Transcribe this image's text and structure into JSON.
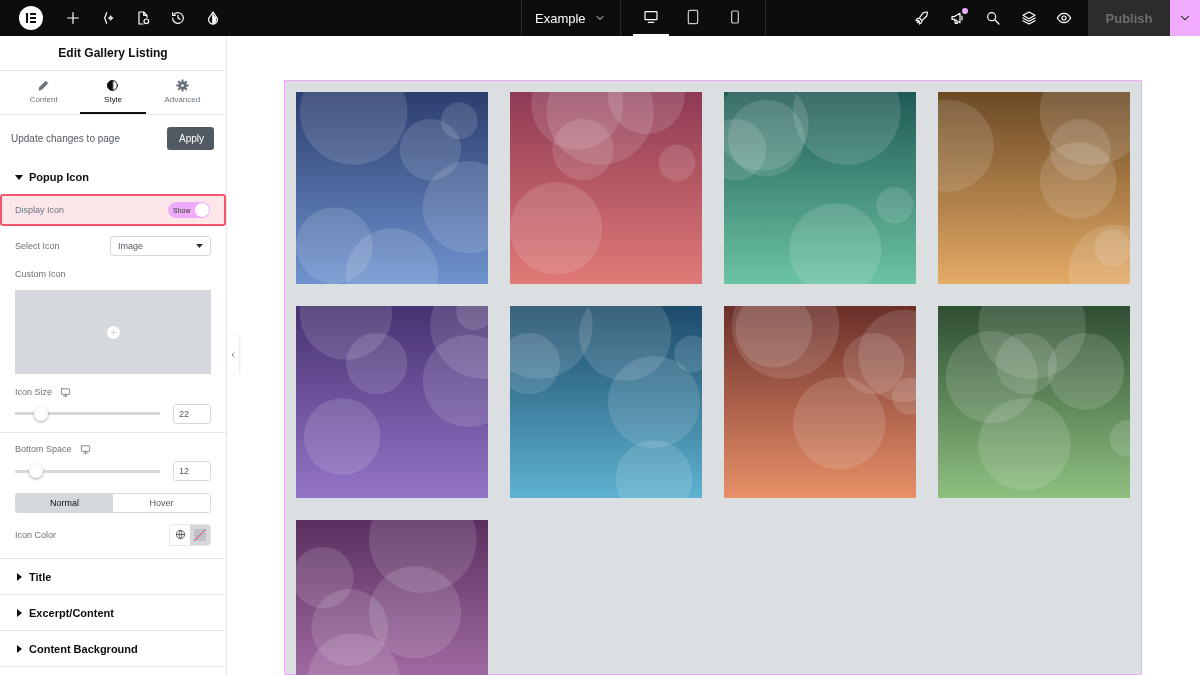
{
  "topbar": {
    "tools": [
      {
        "kind": "add"
      },
      {
        "kind": "sparkle"
      },
      {
        "kind": "page"
      },
      {
        "kind": "history"
      },
      {
        "kind": "drop"
      }
    ],
    "page_selector": {
      "label": "Example"
    },
    "devices": [
      {
        "kind": "desktop",
        "selected": true
      },
      {
        "kind": "tablet",
        "selected": false
      },
      {
        "kind": "mobile",
        "selected": false
      }
    ],
    "actions": [
      {
        "kind": "rocket",
        "badge": false
      },
      {
        "kind": "megaphone",
        "badge": true
      },
      {
        "kind": "search",
        "badge": false
      },
      {
        "kind": "layers",
        "badge": false
      },
      {
        "kind": "eye",
        "badge": false
      }
    ],
    "publish": {
      "label": "Publish",
      "disabled": true
    }
  },
  "panel": {
    "title": "Edit Gallery Listing",
    "tabs": [
      {
        "label": "Content",
        "kind": "pencil",
        "selected": false
      },
      {
        "label": "Style",
        "kind": "contrast",
        "selected": true
      },
      {
        "label": "Advanced",
        "kind": "gear",
        "selected": false
      }
    ],
    "update": {
      "label": "Update changes to page",
      "button": "Apply"
    },
    "sections": [
      {
        "title": "Popup Icon",
        "expanded": true,
        "controls": [
          {
            "kind": "toggle",
            "label": "Display Icon",
            "on": true,
            "state_label": "Show",
            "highlighted": true
          },
          {
            "kind": "select",
            "label": "Select Icon",
            "value": "Image"
          },
          {
            "kind": "media",
            "label": "Custom Icon"
          },
          {
            "kind": "slider",
            "label": "Icon Size",
            "level": 0.18,
            "value": "22",
            "divider": true
          },
          {
            "kind": "slider",
            "label": "Bottom Space",
            "level": 0.145,
            "value": "12",
            "divider": false
          },
          {
            "kind": "switcher",
            "options": [
              {
                "label": "Normal",
                "selected": true
              },
              {
                "label": "Hover",
                "selected": false
              }
            ]
          },
          {
            "kind": "color",
            "label": "Icon Color"
          }
        ]
      },
      {
        "title": "Title",
        "expanded": false
      },
      {
        "title": "Excerpt/Content",
        "expanded": false
      },
      {
        "title": "Content Background",
        "expanded": false
      }
    ]
  }
}
